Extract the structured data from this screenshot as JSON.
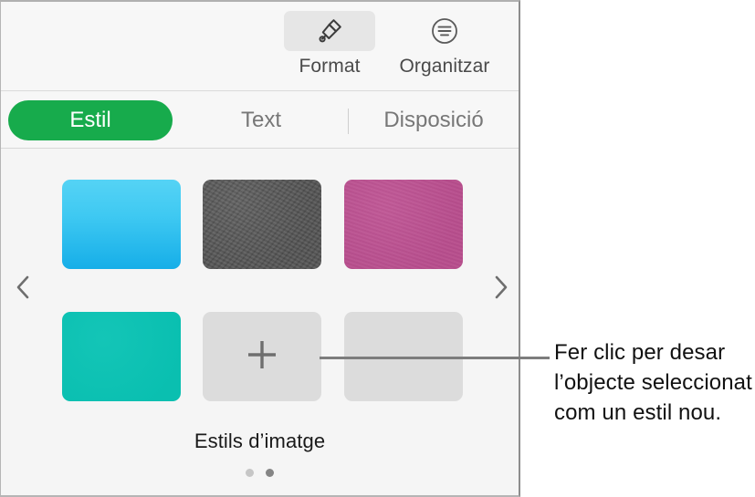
{
  "panel": {
    "toolbar": {
      "buttons": [
        {
          "id": "format",
          "label": "Format",
          "icon": "paintbrush-icon",
          "selected": true
        },
        {
          "id": "organize",
          "label": "Organitzar",
          "icon": "arrange-icon",
          "selected": false
        }
      ]
    },
    "tabs": [
      {
        "id": "estil",
        "label": "Estil",
        "selected": true
      },
      {
        "id": "text",
        "label": "Text",
        "selected": false
      },
      {
        "id": "disposicio",
        "label": "Disposició",
        "selected": false
      }
    ],
    "gallery": {
      "caption": "Estils d’imatge",
      "prev_icon": "chevron-left-icon",
      "next_icon": "chevron-right-icon",
      "add_icon": "plus-icon",
      "swatches": [
        {
          "id": "blue",
          "kind": "gradient",
          "color": "#3fc9f2",
          "label": ""
        },
        {
          "id": "darkgray",
          "kind": "texture",
          "color": "#555555",
          "label": ""
        },
        {
          "id": "pink",
          "kind": "texture",
          "color": "#bd5091",
          "label": ""
        },
        {
          "id": "teal",
          "kind": "solid",
          "color": "#0ac3b4",
          "label": ""
        },
        {
          "id": "add",
          "kind": "add",
          "color": "#dcdcdc",
          "label": ""
        },
        {
          "id": "empty",
          "kind": "empty",
          "color": "#dcdcdc",
          "label": ""
        }
      ],
      "page_dots": [
        {
          "state": "inactive"
        },
        {
          "state": "active"
        }
      ]
    }
  },
  "callout": {
    "text": "Fer clic per desar l’objecte seleccionat com un estil nou."
  },
  "colors": {
    "accent_green": "#17ab4c",
    "panel_bg": "#f5f5f5",
    "toolbar_bg": "#f7f7f7",
    "swatch_placeholder": "#dcdcdc",
    "callout_line": "#7d7d7d"
  }
}
